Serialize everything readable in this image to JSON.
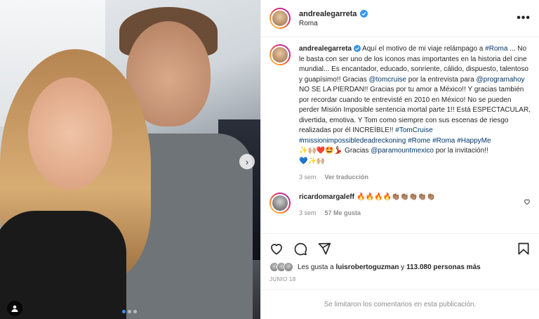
{
  "post": {
    "username": "andrealegarreta",
    "location": "Roma",
    "more_label": "•••"
  },
  "caption": {
    "username": "andrealegarreta",
    "t1": " Aquí el motivo de mi viaje relámpago a ",
    "tag_roma": "#Roma",
    "t2": " ... No le basta con ser uno de los iconos mas importantes en la historia del cine mundial... Es encantador, educado, sonriente, cálido, dispuesto, talentoso y guapísimo!! Gracias ",
    "mention_tom": "@tomcruise",
    "t3": " por la entrevista para ",
    "mention_programa": "@programahoy",
    "t4": " NO SE LA PIERDAN!! Gracias por tu amor a México!! Y gracias también por recordar cuando te entrevisté en 2010 en México! No se pueden perder Misión Imposible sentencia mortal parte 1!! Está ESPECTACULAR, divertida, emotiva. Y Tom como siempre con sus escenas de riesgo realizadas por él INCREÍBLE!! ",
    "tag_tomcruise": "#TomCruise",
    "tag_mission": "#missionimpossibledeadreckoning",
    "tag_rome": "#Rome",
    "tag_roma2": "#Roma",
    "tag_happy": "#HappyMe",
    "emojis1": "✨🙌🏼❤️🤩💃🏻",
    "t5": " Gracias ",
    "mention_paramount": "@paramountmexico",
    "t6": " por la invitación!!",
    "emojis2": "💙✨🙌🏼",
    "time": "3 sem",
    "translate": "Ver traducción"
  },
  "comment": {
    "username": "ricardomargaleff",
    "text": " 🔥🔥🔥🔥👏🏽👏🏽👏🏽👏🏽👏🏽",
    "time": "3 sem",
    "likes": "57 Me gusta"
  },
  "likes": {
    "prefix": "Les gusta a ",
    "user": "luisrobertoguzman",
    "middle": " y ",
    "count": "113.080 personas más"
  },
  "date": "JUNIO 18",
  "footer": "Se limitaron los comentarios en esta publicación."
}
